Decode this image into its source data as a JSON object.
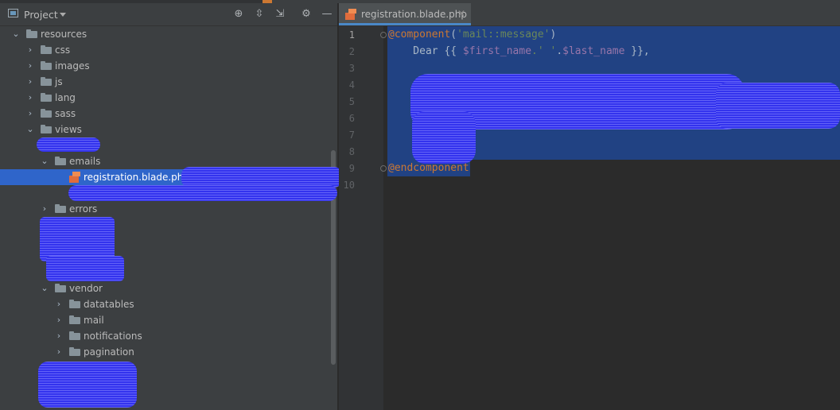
{
  "project_panel": {
    "title": "Project",
    "tree": [
      {
        "label": "resources",
        "expanded": true
      },
      {
        "label": "css"
      },
      {
        "label": "images"
      },
      {
        "label": "js"
      },
      {
        "label": "lang"
      },
      {
        "label": "sass"
      },
      {
        "label": "views",
        "expanded": true
      },
      {
        "label": "emails",
        "expanded": true
      },
      {
        "label": "registration.blade.php",
        "selected": true
      },
      {
        "label": "errors"
      },
      {
        "label": "vendor",
        "expanded": true
      },
      {
        "label": "datatables"
      },
      {
        "label": "mail"
      },
      {
        "label": "notifications"
      },
      {
        "label": "pagination"
      }
    ]
  },
  "editor": {
    "tab_label": "registration.blade.php",
    "line_numbers": [
      "1",
      "2",
      "3",
      "4",
      "5",
      "6",
      "7",
      "8",
      "9",
      "10"
    ],
    "lines": {
      "l1_directive": "@component",
      "l1_open": "(",
      "l1_arg": "'mail::message'",
      "l1_close": ")",
      "l2_dear": "    Dear {{ ",
      "l2_var1": "$first_name",
      "l2_str1": ".' '",
      "l2_dot": ".",
      "l2_var2": "$last_name",
      "l2_end": " }},",
      "l9_directive": "@endcomponent"
    }
  },
  "colors": {
    "selection": "#214283",
    "redaction": "#3333ee",
    "accent": "#4a88c7"
  }
}
